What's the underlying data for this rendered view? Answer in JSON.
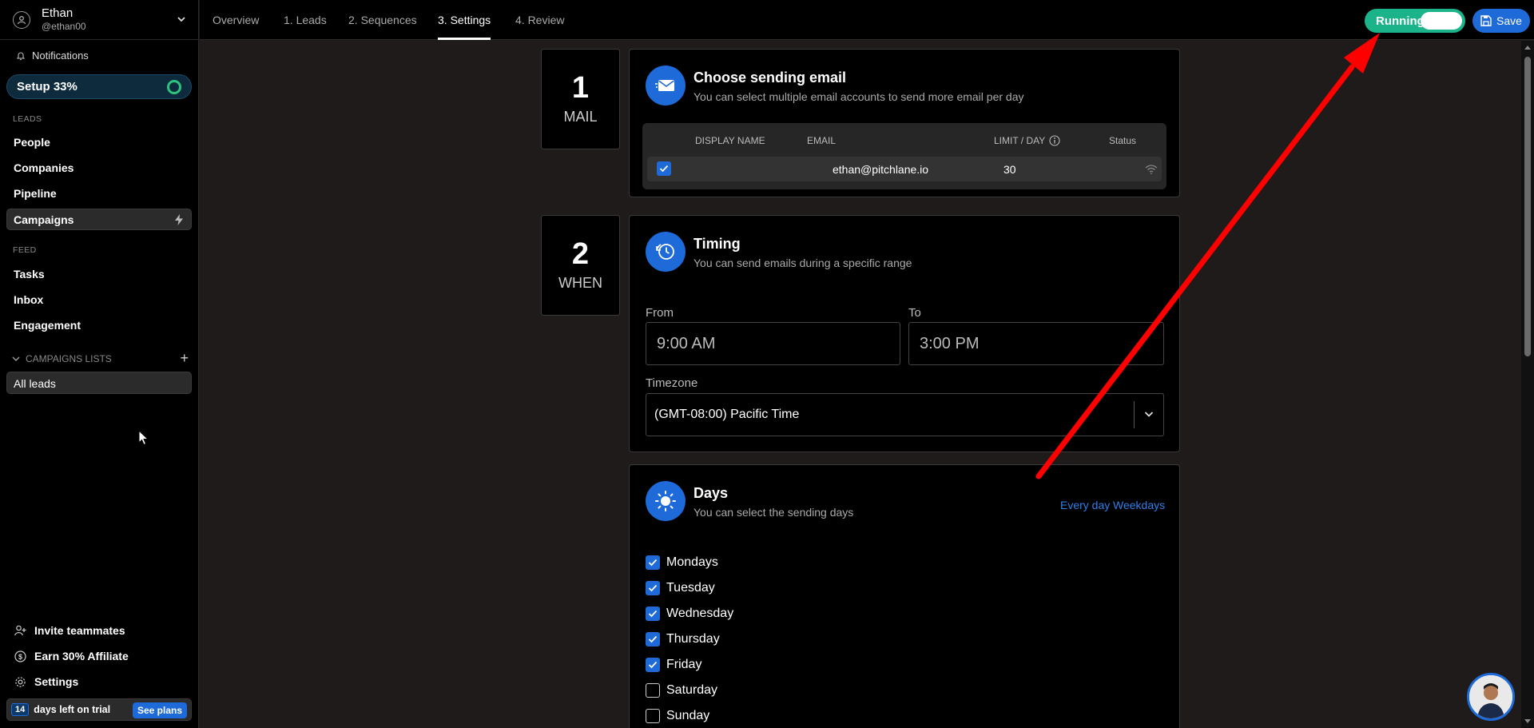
{
  "user": {
    "name": "Ethan",
    "handle": "@ethan00"
  },
  "sidebar": {
    "notifications": "Notifications",
    "setup": "Setup 33%",
    "leads_label": "LEADS",
    "leads_items": [
      "People",
      "Companies",
      "Pipeline"
    ],
    "campaigns": "Campaigns",
    "feed_label": "FEED",
    "feed_items": [
      "Tasks",
      "Inbox",
      "Engagement"
    ],
    "campaigns_lists": "CAMPAIGNS LISTS",
    "all_leads": "All leads",
    "invite": "Invite teammates",
    "affiliate": "Earn 30% Affiliate",
    "settings": "Settings",
    "trial_days": "14",
    "trial_text": "days left on trial",
    "see_plans": "See plans"
  },
  "tabs": [
    "Overview",
    "1. Leads",
    "2. Sequences",
    "3. Settings",
    "4. Review"
  ],
  "header": {
    "running_label": "Running",
    "save_label": "Save"
  },
  "steps": {
    "mail": {
      "num": "1",
      "word": "MAIL",
      "title": "Choose sending email",
      "subtitle": "You can select multiple email accounts to send more email per day"
    },
    "when": {
      "num": "2",
      "word": "WHEN",
      "title": "Timing",
      "subtitle": "You can send emails during a specific range"
    },
    "days": {
      "title": "Days",
      "subtitle": "You can select the sending days",
      "every_day": "Every day",
      "weekdays": "Weekdays"
    }
  },
  "mail_table": {
    "columns": [
      "DISPLAY NAME",
      "EMAIL",
      "LIMIT / DAY",
      "Status"
    ],
    "rows": [
      {
        "display_name": "",
        "email": "ethan@pitchlane.io",
        "limit": "30",
        "checked": true
      }
    ]
  },
  "timing": {
    "from_label": "From",
    "from_value": "9:00 AM",
    "to_label": "To",
    "to_value": "3:00 PM",
    "timezone_label": "Timezone",
    "timezone_value": "(GMT-08:00) Pacific Time"
  },
  "days": [
    {
      "name": "Mondays",
      "checked": true
    },
    {
      "name": "Tuesday",
      "checked": true
    },
    {
      "name": "Wednesday",
      "checked": true
    },
    {
      "name": "Thursday",
      "checked": true
    },
    {
      "name": "Friday",
      "checked": true
    },
    {
      "name": "Saturday",
      "checked": false
    },
    {
      "name": "Sunday",
      "checked": false
    }
  ],
  "colors": {
    "accent": "#1e6ad8",
    "running": "#1ab38a",
    "annotation_arrow": "#ff0000"
  }
}
